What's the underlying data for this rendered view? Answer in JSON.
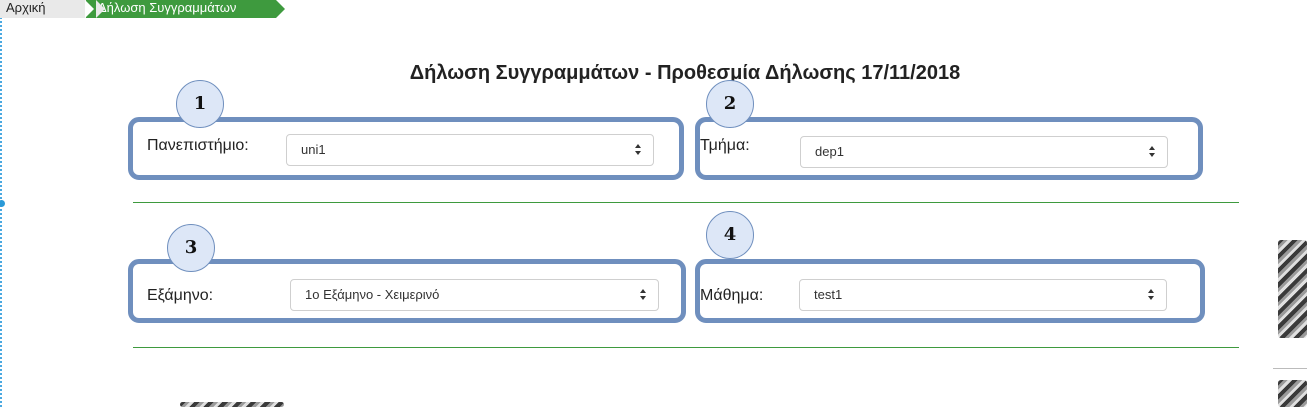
{
  "breadcrumb": {
    "home": "Αρχική",
    "current": "Δήλωση Συγγραμμάτων"
  },
  "title": "Δήλωση Συγγραμμάτων - Προθεσμία Δήλωσης 17/11/2018",
  "fields": {
    "university": {
      "step": "1",
      "label": "Πανεπιστήμιο:",
      "value": "uni1"
    },
    "department": {
      "step": "2",
      "label": "Τμήμα:",
      "value": "dep1"
    },
    "semester": {
      "step": "3",
      "label": "Εξάμηνο:",
      "value": "1ο Εξάμηνο - Χειμερινό"
    },
    "course": {
      "step": "4",
      "label": "Μάθημα:",
      "value": "test1"
    }
  },
  "colors": {
    "accent": "#3e9a3e",
    "highlight_border": "#6f8fbe",
    "badge_fill": "#dde7f7"
  },
  "icons": [
    "select-caret-icon"
  ]
}
